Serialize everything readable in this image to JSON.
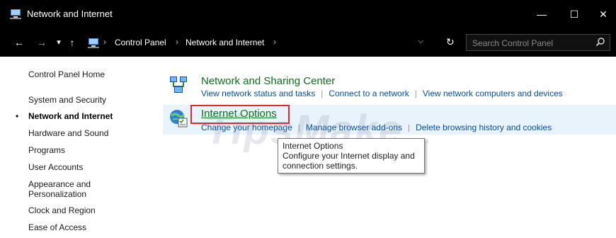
{
  "window": {
    "title": "Network and Internet",
    "minimize_glyph": "—",
    "maximize_glyph": "☐",
    "close_glyph": "✕"
  },
  "nav": {
    "back_glyph": "←",
    "forward_glyph": "→",
    "recent_glyph": "▾",
    "up_glyph": "↑",
    "refresh_glyph": "↻",
    "dropdown_glyph": "⌵"
  },
  "address": {
    "separator": "›",
    "crumbs": [
      "Control Panel",
      "Network and Internet"
    ]
  },
  "search": {
    "placeholder": "Search Control Panel",
    "icon": "search-icon"
  },
  "sidebar": {
    "items": [
      {
        "label": "Control Panel Home"
      },
      {
        "label": "System and Security"
      },
      {
        "label": "Network and Internet",
        "active": true
      },
      {
        "label": "Hardware and Sound"
      },
      {
        "label": "Programs"
      },
      {
        "label": "User Accounts"
      },
      {
        "label": "Appearance and Personalization"
      },
      {
        "label": "Clock and Region"
      },
      {
        "label": "Ease of Access"
      }
    ],
    "bullet": "•"
  },
  "categories": [
    {
      "title": "Network and Sharing Center",
      "icon": "network-icon",
      "links": [
        "View network status and tasks",
        "Connect to a network",
        "View network computers and devices"
      ]
    },
    {
      "title": "Internet Options",
      "icon": "internet-options-icon",
      "links": [
        "Change your homepage",
        "Manage browser add-ons",
        "Delete browsing history and cookies"
      ]
    }
  ],
  "tooltip": {
    "line1": "Internet Options",
    "line2": "Configure your Internet display and",
    "line3": "connection settings."
  },
  "watermark": {
    "text": "TipsMake",
    "suffix": ".com"
  },
  "colors": {
    "titlebar": "#000000",
    "heading_green": "#0e6f1c",
    "link_blue": "#0050a0",
    "highlight_red": "#e3262f",
    "row_highlight": "#e8f3fb"
  }
}
